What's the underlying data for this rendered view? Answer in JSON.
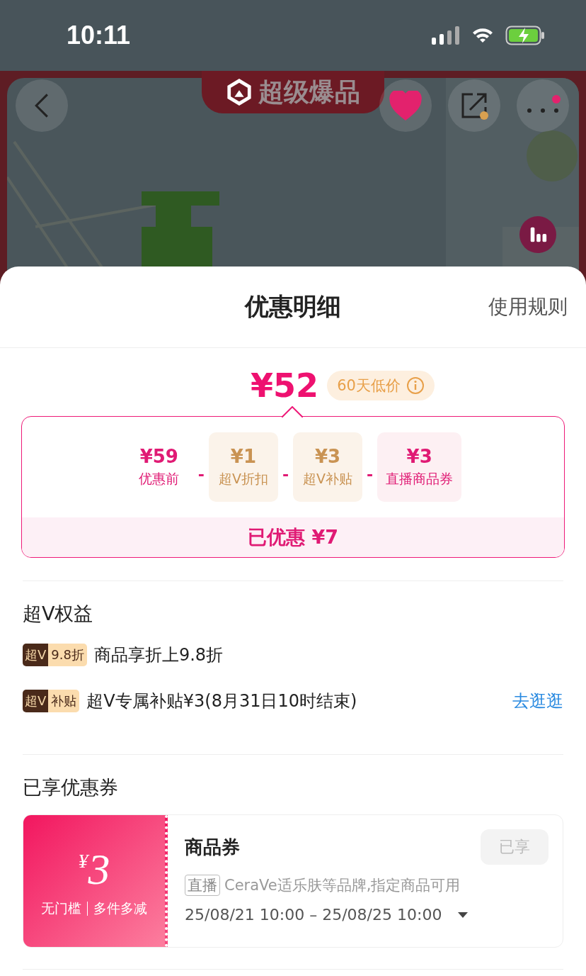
{
  "status_bar": {
    "time": "10:11"
  },
  "hero": {
    "banner": "超级爆品",
    "favorited": true
  },
  "sheet": {
    "title": "优惠明细",
    "rules_link": "使用规则"
  },
  "price": {
    "final": "¥52",
    "tag": "60天低价"
  },
  "breakdown": {
    "items": [
      {
        "kind": "original",
        "amount": "¥59",
        "label": "优惠前"
      },
      {
        "kind": "vip",
        "operator": "-",
        "amount": "¥1",
        "label": "超V折扣"
      },
      {
        "kind": "vip",
        "operator": "-",
        "amount": "¥3",
        "label": "超V补贴"
      },
      {
        "kind": "coupon",
        "operator": "-",
        "amount": "¥3",
        "label": "直播商品券"
      }
    ],
    "total": "已优惠 ¥7"
  },
  "vip_benefits": {
    "title": "超V权益",
    "rows": [
      {
        "badge_left": "超V",
        "badge_right": "9.8折",
        "text": "商品享折上9.8折"
      },
      {
        "badge_left": "超V",
        "badge_right": "补贴",
        "text": "超V专属补贴¥3(8月31日10时结束)",
        "link": "去逛逛"
      }
    ]
  },
  "coupons": {
    "title": "已享优惠券",
    "items": [
      {
        "currency": "¥",
        "amount": "3",
        "conditions": [
          "无门槛",
          "多件多减"
        ],
        "name": "商品券",
        "status": "已享",
        "used": true,
        "tag": "直播",
        "description": "CeraVe适乐肤等品牌,指定商品可用",
        "validity": "25/08/21 10:00 – 25/08/25 10:00"
      }
    ]
  }
}
